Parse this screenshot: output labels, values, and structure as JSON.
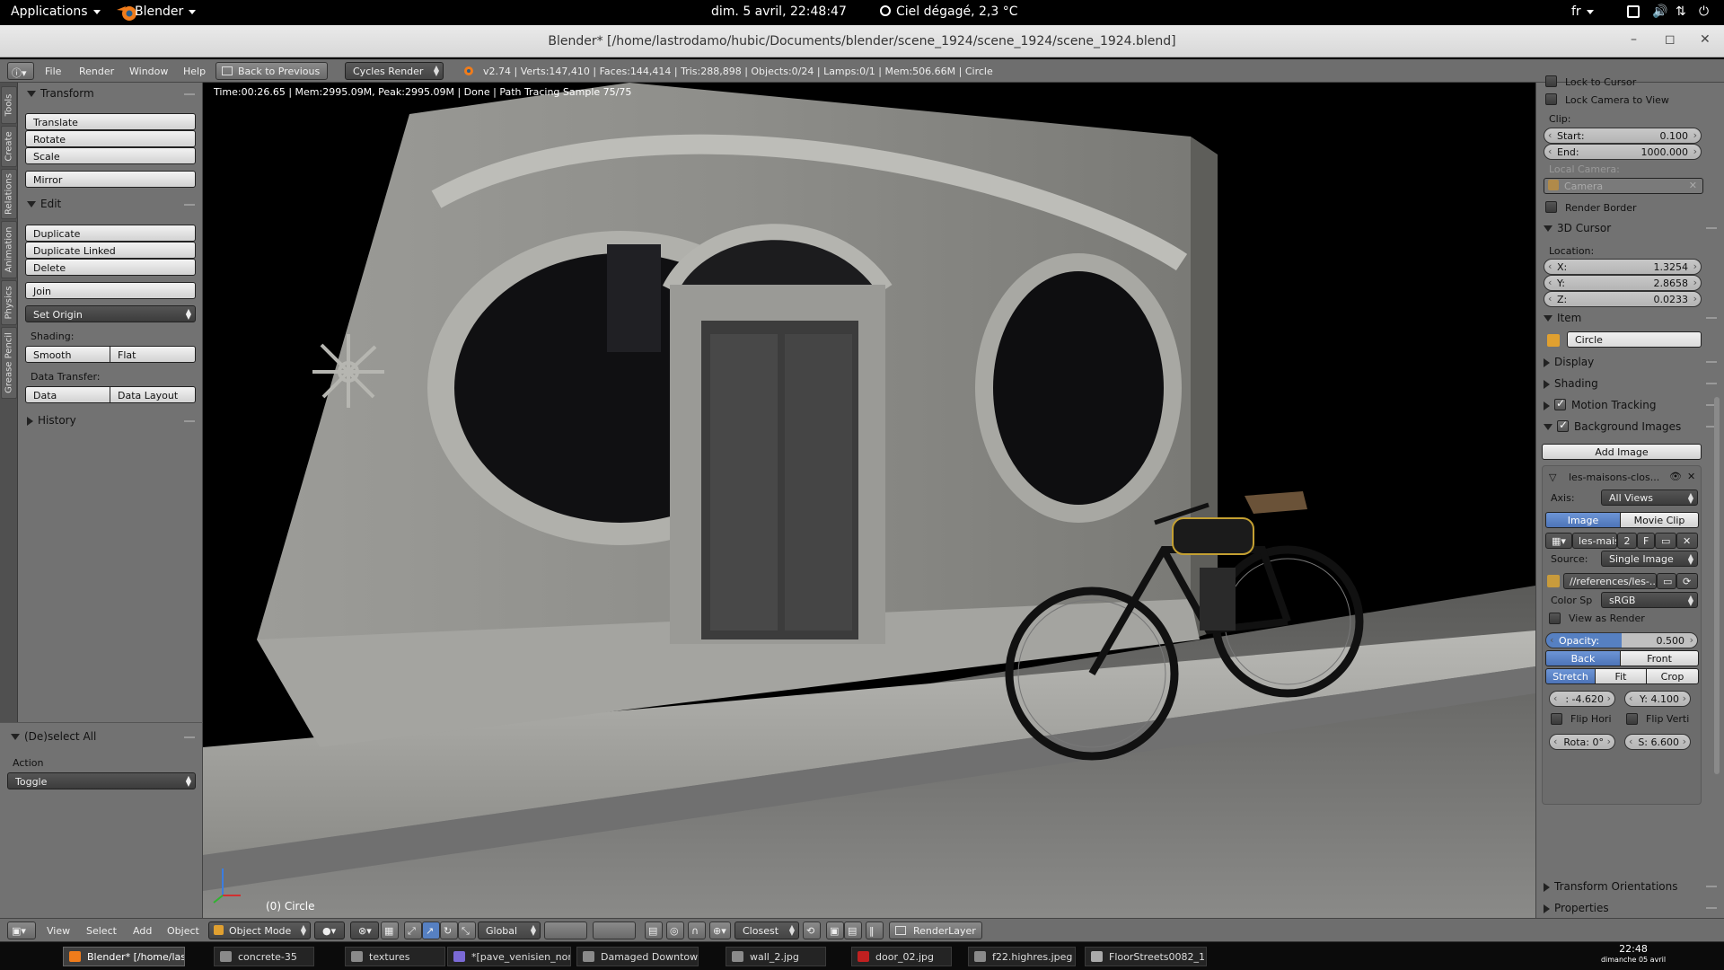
{
  "topbar": {
    "applications": "Applications",
    "app_name": "Blender",
    "datetime": "dim.  5 avril, 22:48:47",
    "weather": "Ciel dégagé, 2,3 °C",
    "lang": "fr"
  },
  "window": {
    "title": "Blender* [/home/lastrodamo/hubic/Documents/blender/scene_1924/scene_1924/scene_1924.blend]"
  },
  "infobar": {
    "menus": [
      "File",
      "Render",
      "Window",
      "Help"
    ],
    "back_label": "Back to Previous",
    "engine": "Cycles Render",
    "stats": "v2.74 | Verts:147,410 | Faces:144,414 | Tris:288,898 | Objects:0/24 | Lamps:0/1 | Mem:506.66M | Circle"
  },
  "tabs": [
    "Tools",
    "Create",
    "Relations",
    "Animation",
    "Physics",
    "Grease Pencil"
  ],
  "toolshelf": {
    "transform": {
      "title": "Transform",
      "buttons": [
        "Translate",
        "Rotate",
        "Scale",
        "Mirror"
      ]
    },
    "edit": {
      "title": "Edit",
      "buttons": [
        "Duplicate",
        "Duplicate Linked",
        "Delete",
        "Join"
      ],
      "set_origin": "Set Origin",
      "shading_label": "Shading:",
      "smooth": "Smooth",
      "flat": "Flat",
      "data_transfer_label": "Data Transfer:",
      "data": "Data",
      "data_layout": "Data Layout"
    },
    "history": "History"
  },
  "operator": {
    "title": "(De)select All",
    "action_label": "Action",
    "action_value": "Toggle"
  },
  "viewport": {
    "info": "Time:00:26.65 | Mem:2995.09M, Peak:2995.09M | Done | Path Tracing Sample 75/75",
    "object": "(0) Circle"
  },
  "props": {
    "lock_cursor": "Lock to Cursor",
    "lock_camera": "Lock Camera to View",
    "clip_label": "Clip:",
    "clip_start_k": "Start:",
    "clip_start_v": "0.100",
    "clip_end_k": "End:",
    "clip_end_v": "1000.000",
    "local_camera": "Local Camera:",
    "camera": "Camera",
    "render_border": "Render Border",
    "cursor_title": "3D Cursor",
    "location_label": "Location:",
    "x_k": "X:",
    "x_v": "1.3254",
    "y_k": "Y:",
    "y_v": "2.8658",
    "z_k": "Z:",
    "z_v": "0.0233",
    "item_title": "Item",
    "item_name": "Circle",
    "display": "Display",
    "shading": "Shading",
    "motion_tracking": "Motion Tracking",
    "bg_images": "Background Images",
    "add_image": "Add Image",
    "bg_name": "les-maisons-clos...",
    "axis_label": "Axis:",
    "axis_value": "All Views",
    "image_tab": "Image",
    "movieclip_tab": "Movie Clip",
    "img_name": "les-mais",
    "img_users": "2",
    "img_fake": "F",
    "source_label": "Source:",
    "source_value": "Single Image",
    "filepath": "//references/les-...",
    "colorsp_label": "Color Sp",
    "colorsp_value": "sRGB",
    "view_as_render": "View as Render",
    "opacity_k": "Opacity:",
    "opacity_v": "0.500",
    "back": "Back",
    "front": "Front",
    "stretch": "Stretch",
    "fit": "Fit",
    "crop": "Crop",
    "offx": ": -4.620",
    "offy": "Y: 4.100",
    "flip_h": "Flip Hori",
    "flip_v": "Flip Verti",
    "rotation": "Rota: 0°",
    "size": "S: 6.600",
    "transform_orient": "Transform Orientations",
    "properties": "Properties"
  },
  "vheader": {
    "menus": [
      "View",
      "Select",
      "Add",
      "Object"
    ],
    "mode": "Object Mode",
    "orientation": "Global",
    "snap": "Closest",
    "render_layer": "RenderLayer"
  },
  "taskbar": {
    "items": [
      "Blender* [/home/las...",
      "concrete-35",
      "textures",
      "*[pave_venisien_nor...",
      "Damaged Downtown",
      "wall_2.jpg",
      "door_02.jpg",
      "f22.highres.jpeg",
      "FloorStreets0082_1..."
    ],
    "clock_time": "22:48",
    "clock_date": "dimanche 05 avril"
  },
  "colors": {
    "accent": "#5680c2",
    "panel": "#727272",
    "header": "#6e6e6e"
  }
}
